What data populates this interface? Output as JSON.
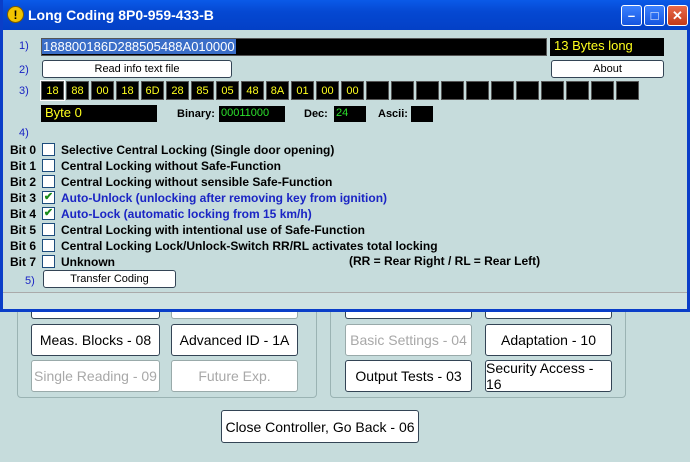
{
  "window": {
    "title": "Long Coding 8P0-959-433-B"
  },
  "rows": {
    "r1": "1)",
    "r2": "2)",
    "r3": "3)",
    "r4": "4)",
    "r5": "5)"
  },
  "coding": {
    "value": "188800186D288505488A010000",
    "length_label": "13 Bytes long"
  },
  "buttons": {
    "read_info": "Read info text file",
    "about": "About",
    "transfer": "Transfer Coding"
  },
  "bytes": [
    "18",
    "88",
    "00",
    "18",
    "6D",
    "28",
    "85",
    "05",
    "48",
    "8A",
    "01",
    "00",
    "00",
    "",
    "",
    "",
    "",
    "",
    "",
    "",
    "",
    "",
    "",
    ""
  ],
  "byte_info": {
    "selected": "Byte 0",
    "binary_label": "Binary:",
    "binary": "00011000",
    "dec_label": "Dec:",
    "dec": "24",
    "ascii_label": "Ascii:",
    "ascii": ""
  },
  "bits": [
    {
      "bit": "Bit 0",
      "label": "Selective Central Locking (Single door opening)",
      "checked": false
    },
    {
      "bit": "Bit 1",
      "label": "Central Locking without Safe-Function",
      "checked": false
    },
    {
      "bit": "Bit 2",
      "label": "Central Locking without sensible Safe-Function",
      "checked": false
    },
    {
      "bit": "Bit 3",
      "label": "Auto-Unlock (unlocking after removing key from ignition)",
      "checked": true
    },
    {
      "bit": "Bit 4",
      "label": "Auto-Lock (automatic locking from 15 km/h)",
      "checked": true
    },
    {
      "bit": "Bit 5",
      "label": "Central Locking with intentional use of Safe-Function",
      "checked": false
    },
    {
      "bit": "Bit 6",
      "label": "Central Locking Lock/Unlock-Switch RR/RL activates total locking",
      "checked": false
    },
    {
      "bit": "Bit 7",
      "label": "Unknown",
      "checked": false
    }
  ],
  "note": "(RR = Rear Right / RL = Rear Left)",
  "background": {
    "meas_blocks": "Meas. Blocks - 08",
    "advanced_id": "Advanced ID - 1A",
    "single_reading": "Single Reading - 09",
    "future_exp": "Future Exp.",
    "basic_settings": "Basic Settings - 04",
    "adaptation": "Adaptation - 10",
    "output_tests": "Output Tests - 03",
    "security_access": "Security Access - 16",
    "close_controller": "Close Controller, Go Back - 06"
  },
  "colors": {
    "titlebar": "#0548d2",
    "dialog_bg": "#c6dcdc",
    "accent_text": "#1a24c4",
    "digit_yellow": "#ffff1e",
    "digit_green": "#2ce02c"
  }
}
